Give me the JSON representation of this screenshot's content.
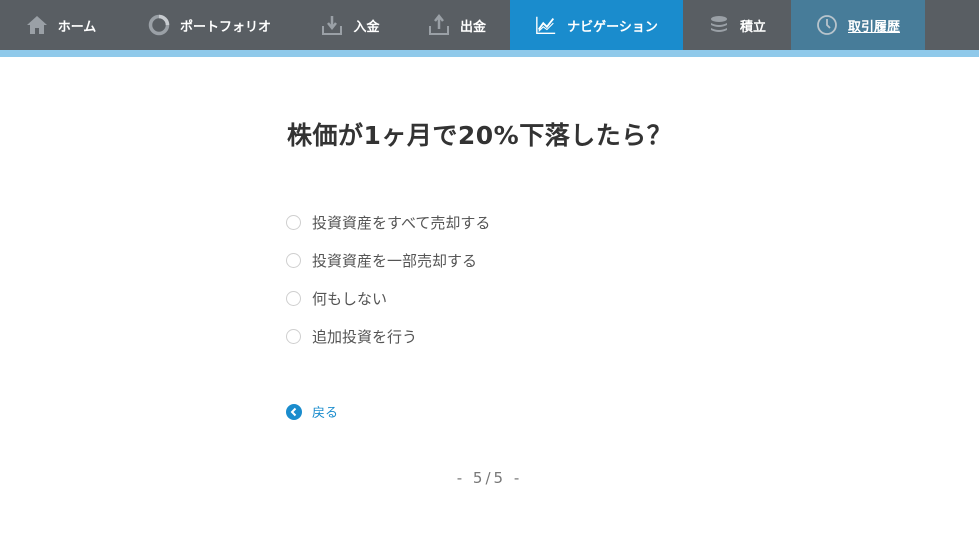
{
  "nav": {
    "items": [
      {
        "label": "ホーム",
        "icon": "home-icon"
      },
      {
        "label": "ポートフォリオ",
        "icon": "portfolio-ring-icon"
      },
      {
        "label": "入金",
        "icon": "deposit-icon"
      },
      {
        "label": "出金",
        "icon": "withdraw-icon"
      },
      {
        "label": "ナビゲーション",
        "icon": "chart-line-icon",
        "active": true
      },
      {
        "label": "積立",
        "icon": "coins-stack-icon"
      },
      {
        "label": "取引履歴",
        "icon": "clock-icon"
      }
    ],
    "accent_color": "#1a8ccd"
  },
  "question": {
    "title": "株価が1ヶ月で20%下落したら？",
    "options": [
      "投資資産をすべて売却する",
      "投資資産を一部売却する",
      "何もしない",
      "追加投資を行う"
    ]
  },
  "back": {
    "label": "戻る"
  },
  "pager": {
    "text": "- 5/5 -"
  }
}
